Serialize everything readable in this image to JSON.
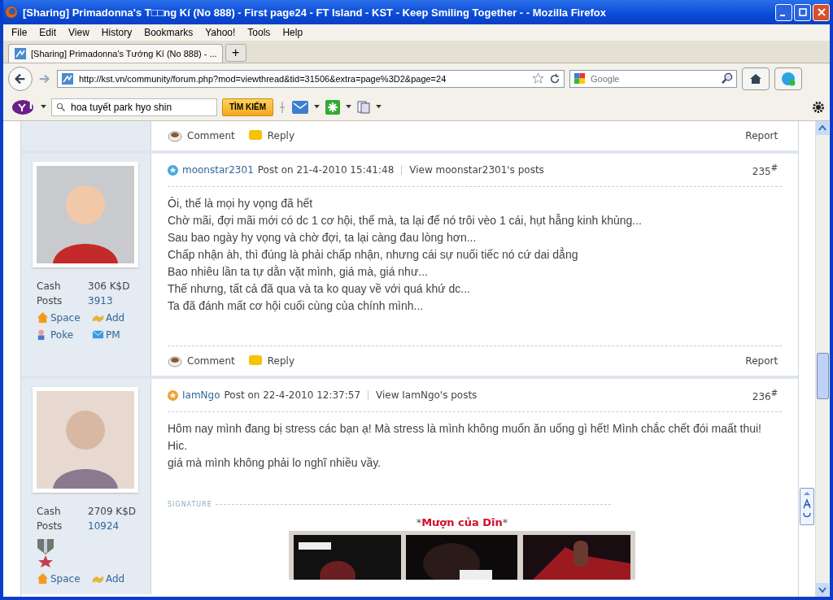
{
  "window": {
    "title": "[Sharing] Primadonna's T□□ng Kí (No 888) - First page24 - FT Island - KST - Keep Smiling Together - - Mozilla Firefox"
  },
  "menu": [
    "File",
    "Edit",
    "View",
    "History",
    "Bookmarks",
    "Yahoo!",
    "Tools",
    "Help"
  ],
  "tabs": [
    {
      "label": "[Sharing] Primadonna's Tướng Kí (No 888) - ...",
      "selected": true
    }
  ],
  "new_tab": "+",
  "address": {
    "value": "http://kst.vn/community/forum.php?mod=viewthread&tid=31506&extra=page%3D2&page=24"
  },
  "search": {
    "placeholder": "Google"
  },
  "yahoo_toolbar": {
    "search_value": "hoa tuyết park hyo shin",
    "search_button": "TÌM KIẾM"
  },
  "previous_footer": {
    "comment": "Comment",
    "reply": "Reply",
    "report": "Report"
  },
  "posts": [
    {
      "author": "moonstar2301",
      "posted": "Post on 21-4-2010 15:41:48",
      "view_link": "View moonstar2301's posts",
      "number": "235$^{#}$",
      "color": "#4aa6dc",
      "body": [
        "Ôi, thế là mọi hy vọng đã hết",
        "Chờ mãi, đợi mãi mới có dc 1 cơ hội, thế mà, ta lại để nó trôi vèo 1 cái, hụt hẫng kinh khủng...",
        "Sau bao ngày hy vọng và chờ đợi, ta lại càng đau lòng hơn...",
        "Chấp nhận àh, thì đúng là phải chấp nhận, nhưng cái sự nuối tiếc nó cứ dai dẳng",
        "Bao nhiêu lần ta tự dằn vặt mình, giá mà, giá như...",
        "Thế nhưng, tất cả đã qua và ta ko quay về với quá khứ dc...",
        "Ta đã đánh mất cơ hội cuối cùng của chính mình..."
      ],
      "stats": [
        {
          "label": "Cash",
          "value": "306 K$D",
          "link": false
        },
        {
          "label": "Posts",
          "value": "3913",
          "link": true
        }
      ],
      "medal": false,
      "actions": [
        [
          "Space",
          "Add"
        ],
        [
          "Poke",
          "PM"
        ]
      ],
      "footer": {
        "comment": "Comment",
        "reply": "Reply",
        "report": "Report"
      }
    },
    {
      "author": "IamNgo",
      "posted": "Post on 22-4-2010 12:37:57",
      "view_link": "View IamNgo's posts",
      "number": "236$^{#}$",
      "color": "#f0a030",
      "body": [
        "Hôm nay mình đang bị stress các bạn ạ! Mà stress là mình không muốn ăn uống gì hết! Mình chắc chết đói maất thui!",
        "Hic.",
        "giá mà mình không phải lo nghĩ nhiều vầy."
      ],
      "stats": [
        {
          "label": "Cash",
          "value": "2709 K$D",
          "link": false
        },
        {
          "label": "Posts",
          "value": "10924",
          "link": true
        }
      ],
      "medal": true,
      "actions": [
        [
          "Space",
          "Add"
        ]
      ],
      "signature": {
        "label": "SIGNATURE",
        "caption": [
          "*",
          "Mượn của Dîn",
          "*"
        ]
      }
    }
  ]
}
